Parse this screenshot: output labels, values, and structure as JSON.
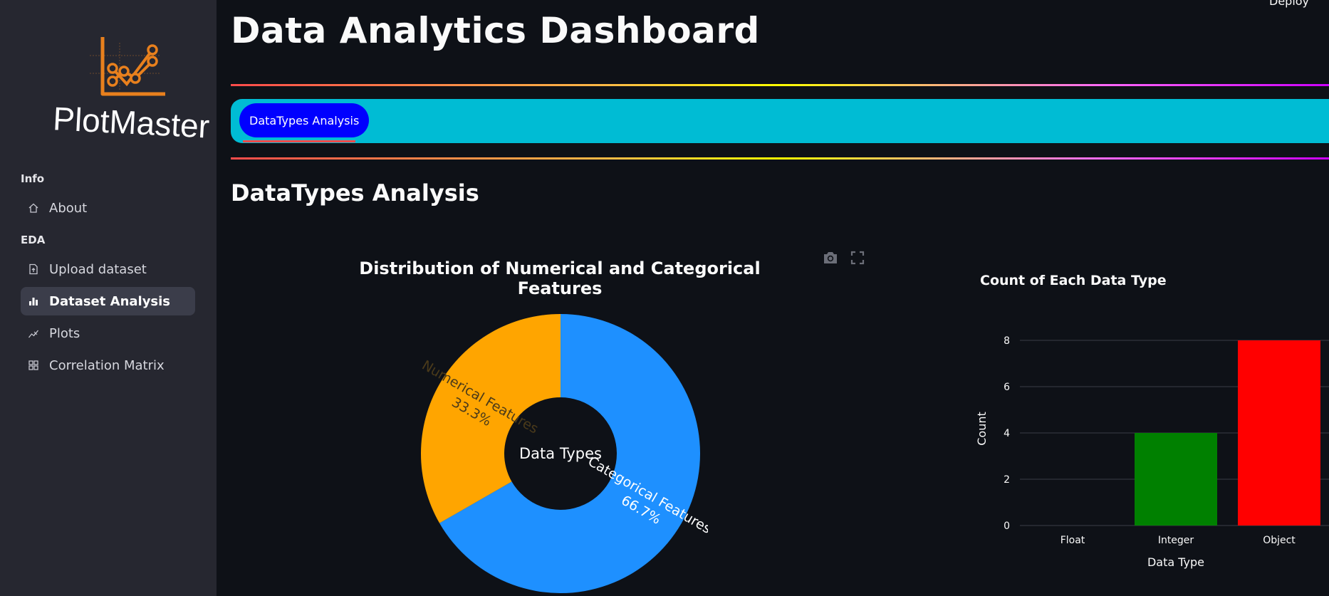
{
  "sidebar": {
    "logo_text": "PlotMaster",
    "sections": [
      {
        "header": "Info",
        "items": [
          {
            "label": "About",
            "icon": "home-icon"
          }
        ]
      },
      {
        "header": "EDA",
        "items": [
          {
            "label": "Upload dataset",
            "icon": "file-upload-icon"
          },
          {
            "label": "Dataset Analysis",
            "icon": "bar-chart-icon",
            "active": true
          },
          {
            "label": "Plots",
            "icon": "line-chart-icon"
          },
          {
            "label": "Correlation Matrix",
            "icon": "grid-icon"
          }
        ]
      }
    ]
  },
  "header": {
    "deploy_label": "Deploy"
  },
  "page": {
    "title": "Data Analytics Dashboard"
  },
  "tabs": [
    {
      "label": "DataTypes Analysis",
      "active": true
    }
  ],
  "section": {
    "title": "DataTypes Analysis"
  },
  "colors": {
    "sidebar_bg": "#262730",
    "main_bg": "#0e1117",
    "tabbar_bg": "#00bcd4",
    "active_tab_bg": "#0000ff",
    "donut_categorical": "#1e90ff",
    "donut_numerical": "#ffa500",
    "bar_integer": "#008000",
    "bar_object": "#ff0000"
  },
  "chart_data": [
    {
      "type": "pie",
      "title": "Distribution of Numerical and Categorical Features",
      "center_label": "Data Types",
      "slices": [
        {
          "label": "Categorical Features",
          "value": 66.7,
          "text": "66.7%",
          "color": "#1e90ff"
        },
        {
          "label": "Numerical Features",
          "value": 33.3,
          "text": "33.3%",
          "color": "#ffa500"
        }
      ]
    },
    {
      "type": "bar",
      "title": "Count of Each Data Type",
      "categories": [
        "Float",
        "Integer",
        "Object"
      ],
      "values": [
        0,
        4,
        8
      ],
      "colors": [
        "#1e90ff",
        "#008000",
        "#ff0000"
      ],
      "xlabel": "Data Type",
      "ylabel": "Count",
      "yticks": [
        "0",
        "2",
        "4",
        "6",
        "8"
      ],
      "ylim": [
        0,
        8
      ]
    }
  ]
}
